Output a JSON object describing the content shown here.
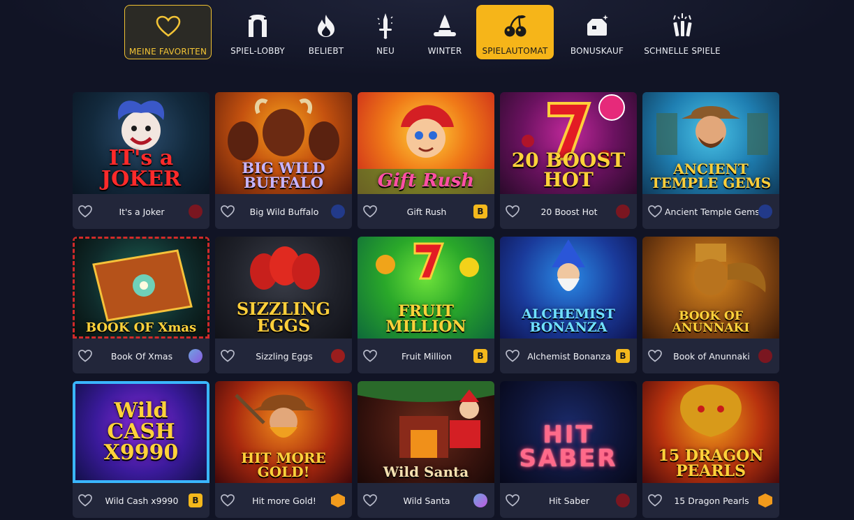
{
  "nav": {
    "items": [
      {
        "label": "MEINE FAVORITEN",
        "icon": "heart-icon"
      },
      {
        "label": "SPIEL-LOBBY",
        "icon": "arch-icon"
      },
      {
        "label": "BELIEBT",
        "icon": "fire-icon"
      },
      {
        "label": "NEU",
        "icon": "sword-icon"
      },
      {
        "label": "WINTER",
        "icon": "witch-hat-icon"
      },
      {
        "label": "SPIELAUTOMAT",
        "icon": "cherries-icon"
      },
      {
        "label": "BONUSKAUF",
        "icon": "gift-box-icon"
      },
      {
        "label": "SCHNELLE SPIELE",
        "icon": "fireworks-icon"
      }
    ],
    "active": "SPIELAUTOMAT",
    "accent": "#f6b519"
  },
  "games": [
    {
      "title": "It's a Joker",
      "logo": "IT's a JOKER",
      "provider_color": "#7a1620"
    },
    {
      "title": "Big Wild Buffalo",
      "logo": "BIG WILD BUFFALO",
      "provider_color": "#223a8a"
    },
    {
      "title": "Gift Rush",
      "logo": "Gift Rush",
      "provider_color": "#f4b81c",
      "provider_mark": "B"
    },
    {
      "title": "20 Boost Hot",
      "logo": "20 BOOST HOT",
      "provider_color": "#7a1620"
    },
    {
      "title": "Ancient Temple Gems",
      "logo": "ANCIENT TEMPLE GEMS",
      "provider_color": "#223a8a"
    },
    {
      "title": "Book Of Xmas",
      "logo": "BOOK OF Xmas",
      "provider_color": "#6fa3e0"
    },
    {
      "title": "Sizzling Eggs",
      "logo": "SIZZLING EGGS",
      "provider_color": "#9a1d1d"
    },
    {
      "title": "Fruit Million",
      "logo": "FRUIT MILLION",
      "provider_color": "#f4b81c",
      "provider_mark": "B"
    },
    {
      "title": "Alchemist Bonanza",
      "logo": "ALCHEMIST BONANZA",
      "provider_color": "#f4b81c",
      "provider_mark": "B"
    },
    {
      "title": "Book of Anunnaki",
      "logo": "BOOK OF ANUNNAKI",
      "provider_color": "#7a1620"
    },
    {
      "title": "Wild Cash x9990",
      "logo": "Wild CASH X9990",
      "provider_color": "#f4b81c",
      "provider_mark": "B"
    },
    {
      "title": "Hit more Gold!",
      "logo": "HIT MORE GOLD!",
      "provider_color": "#f29b1c"
    },
    {
      "title": "Wild Santa",
      "logo": "Wild Santa",
      "provider_color": "#8a7ad8"
    },
    {
      "title": "Hit Saber",
      "logo": "HIT SABER",
      "provider_color": "#7a1620"
    },
    {
      "title": "15 Dragon Pearls",
      "logo": "15 DRAGON PEARLS",
      "provider_color": "#f29b1c"
    }
  ]
}
